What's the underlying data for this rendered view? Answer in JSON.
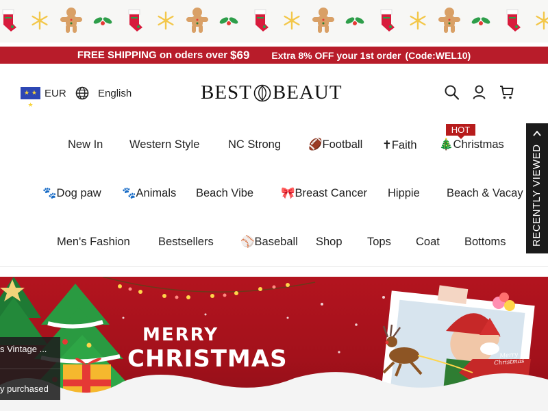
{
  "promo": {
    "shipping_text": "FREE SHIPPING on oders over",
    "shipping_amount": "$69",
    "discount_text": "Extra 8% OFF your 1st order",
    "discount_code": "(Code:WEL10)"
  },
  "header": {
    "currency": "EUR",
    "language": "English",
    "logo_left": "BEST",
    "logo_right": "BEAUT",
    "icons": [
      "search-icon",
      "account-icon",
      "cart-icon"
    ]
  },
  "nav": {
    "hot_badge": "HOT",
    "rows": [
      [
        "New In",
        "Western Style",
        "NC Strong",
        "🏈Football",
        "✝Faith",
        "🎄Christmas"
      ],
      [
        "🐾Dog paw",
        "🐾Animals",
        "Beach Vibe",
        "🎀Breast Cancer",
        "Hippie",
        "Beach & Vacay"
      ],
      [
        "Men's Fashion",
        "Bestsellers",
        "⚾Baseball",
        "Shop",
        "Tops",
        "Coat",
        "Bottoms"
      ]
    ]
  },
  "recently_viewed": "RECENTLY VIEWED",
  "banner": {
    "title_line1": "MERRY",
    "title_line2": "CHRISTMAS",
    "sign_line1": "Merry",
    "sign_line2": "Christmas"
  },
  "notification": {
    "product": "s Vintage ...",
    "status": "y purchased"
  },
  "colors": {
    "promo_red": "#b81c2a",
    "banner_red": "#b3141f",
    "side_tab": "#1b1b1b",
    "hot_red": "#b71c1c"
  }
}
